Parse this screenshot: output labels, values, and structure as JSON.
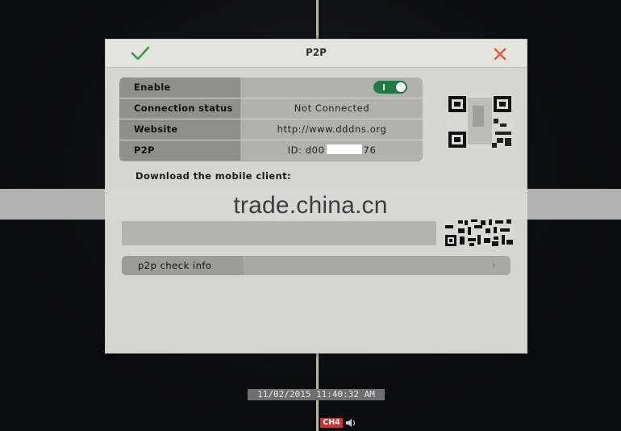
{
  "dialog": {
    "title": "P2P",
    "rows": [
      {
        "label": "Enable",
        "value": ""
      },
      {
        "label": "Connection status",
        "value": "Not Connected"
      },
      {
        "label": "Website",
        "value": "http://www.dddns.org"
      },
      {
        "label": "P2P",
        "value_prefix": "ID:  d00",
        "value_suffix": "76"
      }
    ],
    "enable_toggle": {
      "state": "on",
      "color": "#1f7a45"
    },
    "download_label": "Download the mobile client:",
    "p2p_check": {
      "label": "p2p check info",
      "chevron": "›"
    }
  },
  "icons": {
    "ok": "checkmark-icon",
    "close": "close-x-icon",
    "speaker": "speaker-icon"
  },
  "colors": {
    "ok": "#3a9a4a",
    "close": "#e2553a",
    "channel_badge": "#d0302b"
  },
  "watermark": "trade.china.cn",
  "osd": {
    "timestamp": "11/02/2015  11:40:32 AM",
    "channel": "CH4"
  }
}
